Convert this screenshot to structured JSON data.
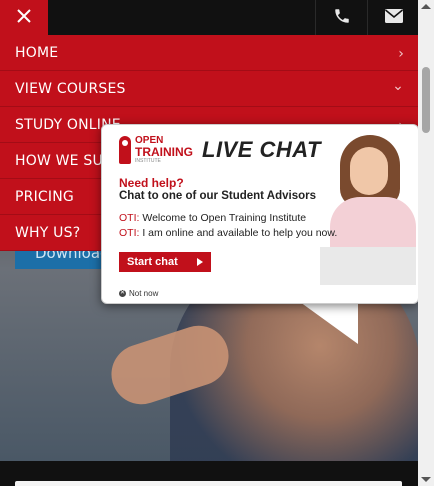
{
  "menu": {
    "items": [
      {
        "label": "HOME",
        "chevron": "›"
      },
      {
        "label": "VIEW COURSES",
        "chevron": "⌄"
      },
      {
        "label": "STUDY ONLINE",
        "chevron": "›"
      },
      {
        "label": "HOW WE SUPPORT YOU",
        "chevron": "›"
      },
      {
        "label": "PRICING",
        "chevron": "›"
      },
      {
        "label": "WHY US?",
        "chevron": "›"
      }
    ]
  },
  "hero": {
    "download_label": "Download"
  },
  "chat": {
    "logo_line1": "OPEN",
    "logo_line2": "TRAINING",
    "logo_line3": "INSTITUTE",
    "title": "LIVE CHAT",
    "need_help": "Need help?",
    "chat_with": "Chat to one of our Student Advisors",
    "messages": [
      {
        "who": "OTI:",
        "text": "Welcome to Open Training Institute"
      },
      {
        "who": "OTI:",
        "text": "I am online and available to help you now."
      }
    ],
    "start_label": "Start chat",
    "not_now_label": "Not now"
  },
  "colors": {
    "brand_red": "#c1101b",
    "download_blue": "#1c6fa8"
  },
  "icons": {
    "close": "close-icon",
    "phone": "phone-icon",
    "email": "envelope-icon"
  }
}
